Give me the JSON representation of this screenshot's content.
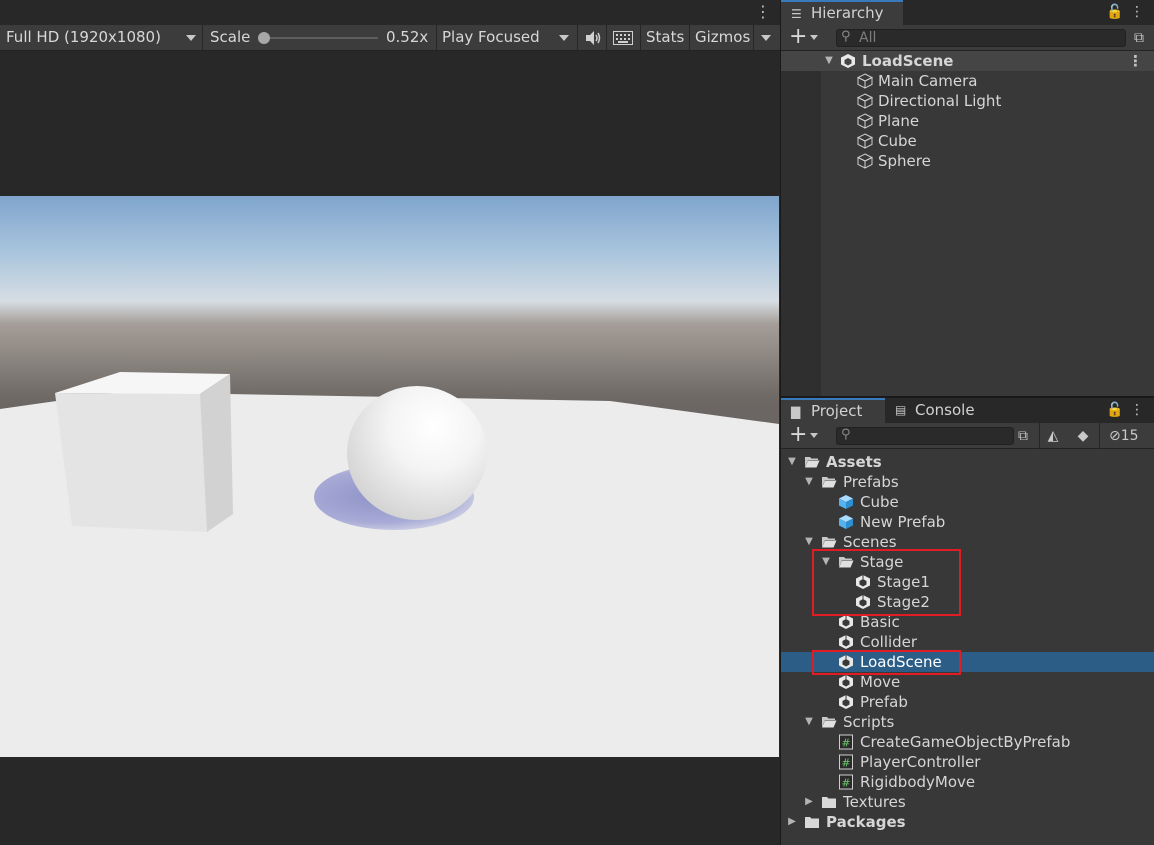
{
  "game": {
    "menu_glyph": "⋮",
    "toolbar": {
      "resolution": "Full HD (1920x1080)",
      "scale_label": "Scale",
      "scale_value": "0.52x",
      "scale_fraction": 0.0,
      "play_mode": "Play Focused",
      "mute_icon": "speaker-icon",
      "keyboard_icon": "keyboard-icon",
      "stats_label": "Stats",
      "gizmos_label": "Gizmos"
    }
  },
  "hierarchy": {
    "tab_label": "Hierarchy",
    "search_placeholder": "All",
    "scene_name": "LoadScene",
    "objects": [
      "Main Camera",
      "Directional Light",
      "Plane",
      "Cube",
      "Sphere"
    ]
  },
  "project": {
    "tab_label": "Project",
    "console_tab_label": "Console",
    "hidden_count": "15",
    "tree": [
      {
        "label": "Assets",
        "icon": "folder-open-icon",
        "expanded": true,
        "bold": true
      },
      {
        "label": "Prefabs",
        "icon": "folder-open-icon",
        "expanded": true
      },
      {
        "label": "Cube",
        "icon": "prefab-icon"
      },
      {
        "label": "New Prefab",
        "icon": "prefab-icon"
      },
      {
        "label": "Scenes",
        "icon": "folder-open-icon",
        "expanded": true
      },
      {
        "label": "Stage",
        "icon": "folder-open-icon",
        "expanded": true
      },
      {
        "label": "Stage1",
        "icon": "scene-icon"
      },
      {
        "label": "Stage2",
        "icon": "scene-icon"
      },
      {
        "label": "Basic",
        "icon": "scene-icon"
      },
      {
        "label": "Collider",
        "icon": "scene-icon"
      },
      {
        "label": "LoadScene",
        "icon": "scene-icon",
        "selected": true
      },
      {
        "label": "Move",
        "icon": "scene-icon"
      },
      {
        "label": "Prefab",
        "icon": "scene-icon"
      },
      {
        "label": "Scripts",
        "icon": "folder-open-icon",
        "expanded": true
      },
      {
        "label": "CreateGameObjectByPrefab",
        "icon": "script-icon"
      },
      {
        "label": "PlayerController",
        "icon": "script-icon"
      },
      {
        "label": "RigidbodyMove",
        "icon": "script-icon"
      },
      {
        "label": "Textures",
        "icon": "folder-closed-icon",
        "expanded": false
      },
      {
        "label": "Packages",
        "icon": "folder-closed-icon",
        "expanded": false,
        "bold": true
      }
    ]
  },
  "colors": {
    "selection": "#2c5d87",
    "annotation_box": "#e21c24",
    "tab_accent": "#3a79bb"
  }
}
